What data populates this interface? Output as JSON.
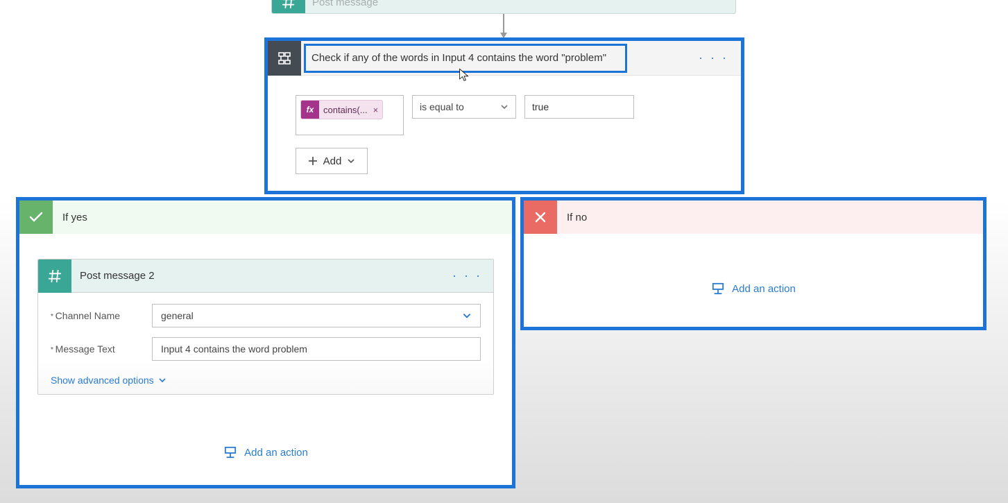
{
  "top_action": {
    "title": "Post message"
  },
  "condition": {
    "title": "Check if any of the words in Input 4 contains the word \"problem\"",
    "expression_pill": "contains(...",
    "operator": "is equal to",
    "value": "true",
    "add_label": "Add"
  },
  "branches": {
    "yes": {
      "title": "If yes",
      "action": {
        "title": "Post message 2",
        "fields": {
          "channel_label": "Channel Name",
          "channel_value": "general",
          "message_label": "Message Text",
          "message_value": "Input 4 contains the word problem"
        },
        "advanced": "Show advanced options"
      },
      "add_action": "Add an action"
    },
    "no": {
      "title": "If no",
      "add_action": "Add an action"
    }
  }
}
